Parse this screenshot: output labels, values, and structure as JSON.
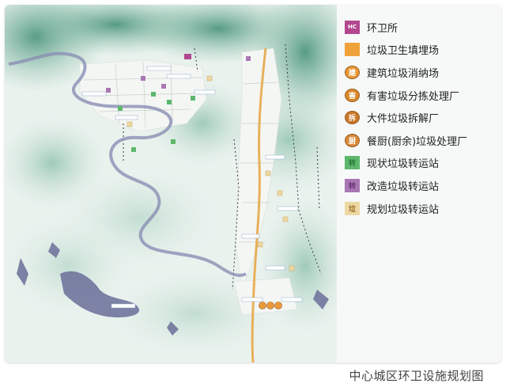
{
  "legend": {
    "items": [
      {
        "label": "环卫所",
        "icon": "hc-rect-icon",
        "glyph": "HC",
        "color": "#b3478f"
      },
      {
        "label": "垃圾卫生填埋场",
        "icon": "landfill-rect-icon",
        "glyph": "",
        "color": "#f0a23a"
      },
      {
        "label": "建筑垃圾消纳场",
        "icon": "construction-waste-circle-icon",
        "glyph": "建",
        "color": "#e99a38"
      },
      {
        "label": "有害垃圾分拣处理厂",
        "icon": "hazardous-waste-circle-icon",
        "glyph": "害",
        "color": "#d98a2b"
      },
      {
        "label": "大件垃圾拆解厂",
        "icon": "bulky-waste-circle-icon",
        "glyph": "拆",
        "color": "#c9792a"
      },
      {
        "label": "餐厨(厨余)垃圾处理厂",
        "icon": "kitchen-waste-circle-icon",
        "glyph": "厨",
        "color": "#d78a38"
      },
      {
        "label": "现状垃圾转运站",
        "icon": "existing-transfer-station-icon",
        "glyph": "转",
        "color": "#5db86c"
      },
      {
        "label": "改造垃圾转运站",
        "icon": "renovated-transfer-station-icon",
        "glyph": "转",
        "color": "#a977b3"
      },
      {
        "label": "规划垃圾转运站",
        "icon": "planned-transfer-station-icon",
        "glyph": "垃",
        "color": "#edd8a4"
      }
    ]
  },
  "caption": "中心城区环卫设施规划图"
}
